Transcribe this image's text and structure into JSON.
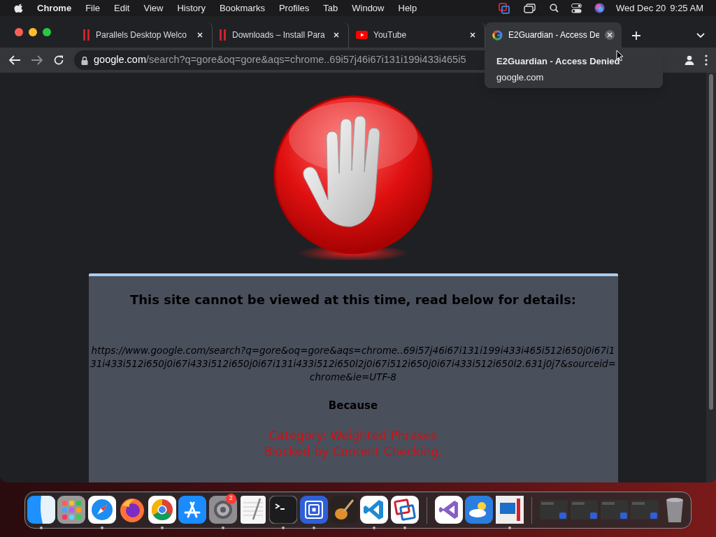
{
  "menu_bar": {
    "app": "Chrome",
    "menus": [
      "File",
      "Edit",
      "View",
      "History",
      "Bookmarks",
      "Profiles",
      "Tab",
      "Window",
      "Help"
    ],
    "date": "Wed Dec 20",
    "time": "9:25 AM"
  },
  "tabs": [
    {
      "title": "Parallels Desktop Welco",
      "kind": "bars",
      "selected": false
    },
    {
      "title": "Downloads – Install Para",
      "kind": "bars",
      "selected": false
    },
    {
      "title": "YouTube",
      "kind": "play",
      "selected": false
    },
    {
      "title": "E2Guardian - Access De",
      "kind": "ring",
      "selected": true
    }
  ],
  "tab_tooltip": {
    "title": "E2Guardian - Access Denied",
    "host": "google.com"
  },
  "address_bar": {
    "host": "google.com",
    "path": "/search?q=gore&oq=gore&aqs=chrome..69i57j46i67i131i199i433i465i5"
  },
  "page": {
    "heading": "This site cannot be viewed at this time, read below for details:",
    "url": "https://www.google.com/search?q=gore&oq=gore&aqs=chrome..69i57j46i67i131i199i433i465i512i650j0i67i131i433i512i650j0i67i433i512i650j0i67i131i433i512i650l2j0i67i512i650j0i67i433i512i650l2.631j0j7&sourceid=chrome&ie=UTF-8",
    "because": "Because",
    "reasons": [
      "Category: Weighted Phrases",
      "Blocked by Content Checking."
    ]
  },
  "dock": {
    "apps": [
      {
        "kind": "finder",
        "running": true
      },
      {
        "kind": "launchpad",
        "running": false
      },
      {
        "kind": "safari",
        "running": true
      },
      {
        "kind": "firefox",
        "running": false
      },
      {
        "kind": "chrome",
        "running": true
      },
      {
        "kind": "appstore",
        "running": false
      },
      {
        "kind": "settings",
        "running": true,
        "badge": "2"
      },
      {
        "kind": "textedit",
        "running": false
      },
      {
        "kind": "terminal",
        "running": true
      },
      {
        "kind": "squares",
        "running": true
      },
      {
        "kind": "guitar",
        "running": false
      },
      {
        "kind": "vscode",
        "running": true
      },
      {
        "kind": "parallels",
        "running": true
      }
    ],
    "recent": [
      {
        "kind": "vs",
        "running": false
      },
      {
        "kind": "weather",
        "running": false
      },
      {
        "kind": "window",
        "running": true
      }
    ],
    "windows": [
      {
        "kind": "thumbnail"
      },
      {
        "kind": "thumbnail"
      },
      {
        "kind": "thumbnail"
      },
      {
        "kind": "thumbnail"
      }
    ]
  }
}
